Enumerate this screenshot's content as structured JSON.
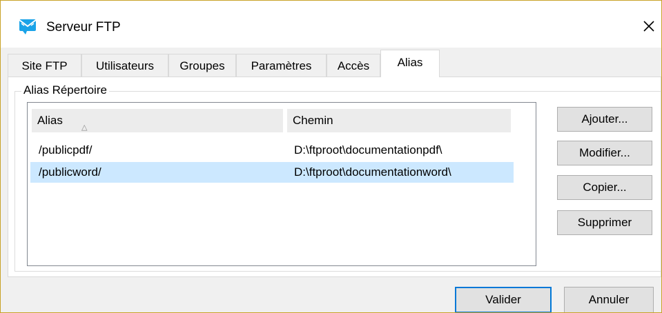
{
  "window": {
    "title": "Serveur FTP"
  },
  "tabs": [
    {
      "label": "Site FTP",
      "active": false
    },
    {
      "label": "Utilisateurs",
      "active": false
    },
    {
      "label": "Groupes",
      "active": false
    },
    {
      "label": "Paramètres",
      "active": false
    },
    {
      "label": "Accès",
      "active": false
    },
    {
      "label": "Alias",
      "active": true
    }
  ],
  "group": {
    "label": "Alias Répertoire"
  },
  "list": {
    "columns": [
      {
        "label": "Alias",
        "sort": "ascending"
      },
      {
        "label": "Chemin"
      }
    ],
    "rows": [
      {
        "alias": "/publicpdf/",
        "path": "D:\\ftproot\\documentationpdf\\",
        "selected": false
      },
      {
        "alias": "/publicword/",
        "path": "D:\\ftproot\\documentationword\\",
        "selected": true
      }
    ]
  },
  "actions": {
    "add": "Ajouter...",
    "modify": "Modifier...",
    "copy": "Copier...",
    "delete": "Supprimer"
  },
  "footer": {
    "ok": "Valider",
    "cancel": "Annuler"
  },
  "colors": {
    "selection": "#cce8ff",
    "focus_border": "#0078d7",
    "app_icon": "#1aa3e8"
  }
}
